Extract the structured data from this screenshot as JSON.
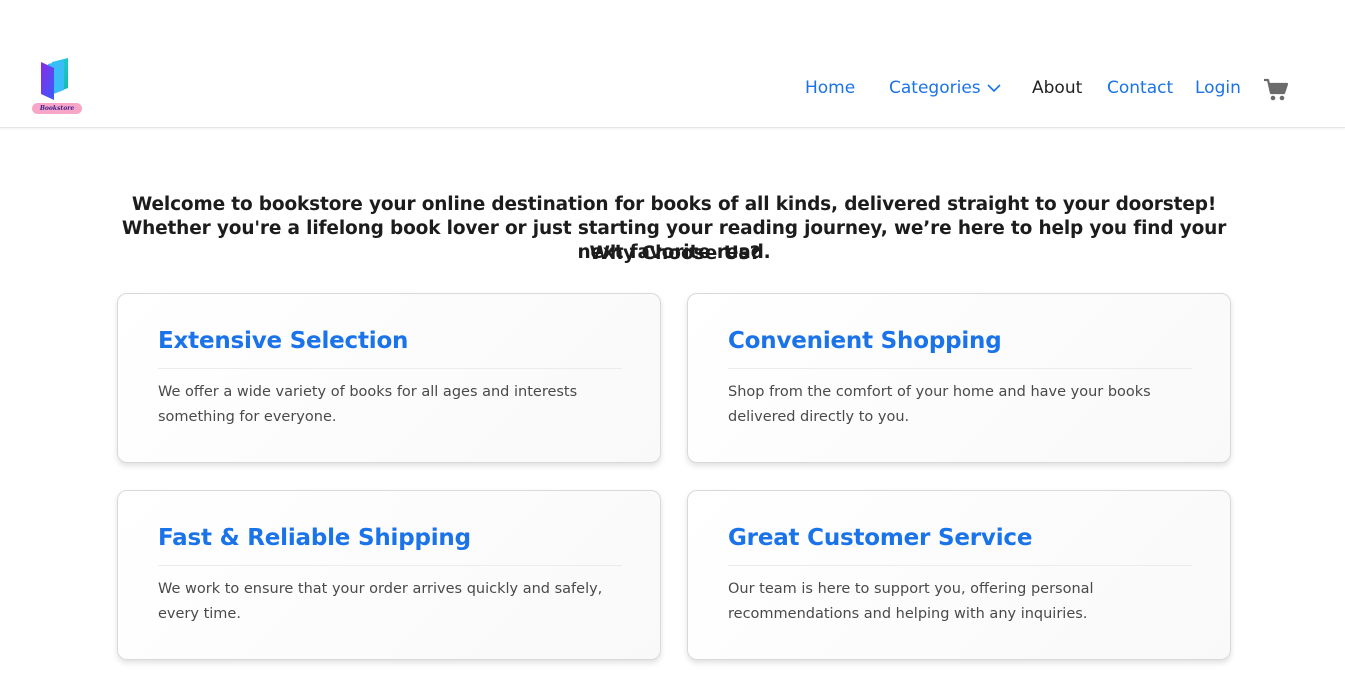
{
  "brand": {
    "logo_text": "Bookstore"
  },
  "nav": {
    "home": "Home",
    "categories": "Categories",
    "about": "About",
    "contact": "Contact",
    "login": "Login"
  },
  "intro": {
    "text": "Welcome to bookstore your online destination for books of all kinds, delivered straight to your doorstep! Whether you're a lifelong book lover or just starting your reading journey, we’re here to help you find your next favorite read."
  },
  "why": {
    "heading": "Why Choose Us?"
  },
  "features": [
    {
      "title": "Extensive Selection",
      "text": "We offer a wide variety of books for all ages and interests something for everyone."
    },
    {
      "title": "Convenient Shopping",
      "text": "Shop from the comfort of your home and have your books delivered directly to you."
    },
    {
      "title": "Fast & Reliable Shipping",
      "text": "We work to ensure that your order arrives quickly and safely, every time."
    },
    {
      "title": "Great Customer Service",
      "text": "Our team is here to support you, offering personal recommendations and helping with any inquiries."
    }
  ],
  "colors": {
    "accent": "#1a73e8",
    "text": "#1c1c1c",
    "muted": "#4a4a4a"
  },
  "icons": [
    "logo-book-icon",
    "chevron-down-icon",
    "cart-icon"
  ]
}
